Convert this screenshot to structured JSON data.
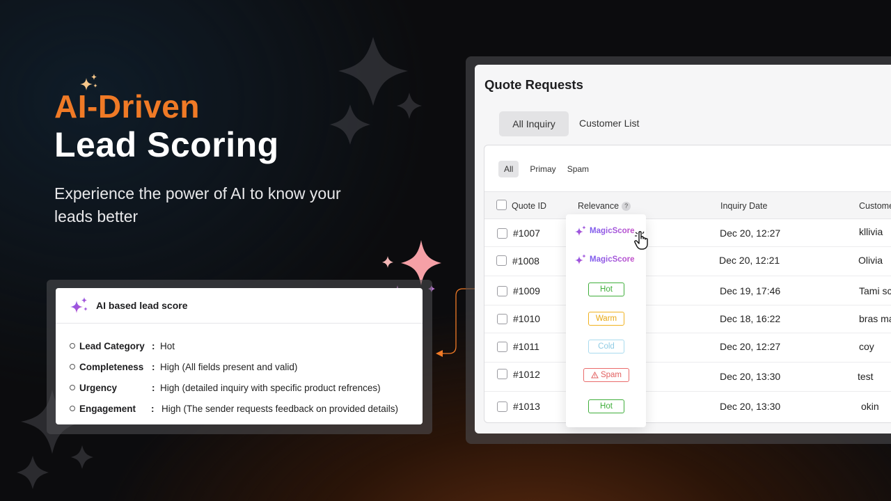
{
  "hero": {
    "title_accent": "AI-Driven",
    "title_main": "Lead Scoring",
    "subtitle": "Experience the power of AI to know your leads better"
  },
  "lead_card": {
    "title": "AI based lead score",
    "rows": [
      {
        "key": "Lead Category",
        "value": "Hot"
      },
      {
        "key": "Completeness",
        "value": "High (All fields present and valid)"
      },
      {
        "key": "Urgency",
        "value": "High (detailed inquiry with specific product refrences)"
      },
      {
        "key": "Engagement",
        "value": "High (The sender requests feedback on provided details)"
      }
    ]
  },
  "quote_requests": {
    "title": "Quote Requests",
    "tabs": [
      "All Inquiry",
      "Customer List"
    ],
    "filters": [
      "All",
      "Primay",
      "Spam"
    ],
    "columns": [
      "Quote ID",
      "Relevance",
      "Inquiry Date",
      "Custome"
    ],
    "help_glyph": "?",
    "magicscore_label": "MagicScore",
    "rows": [
      {
        "id": "#1007",
        "relevance": "MagicScore",
        "date": "Dec 20, 12:27",
        "customer": "kllivia"
      },
      {
        "id": "#1008",
        "relevance": "MagicScore",
        "date": "Dec 20, 12:21",
        "customer": "Olivia"
      },
      {
        "id": "#1009",
        "relevance": "Hot",
        "date": "Dec 19, 17:46",
        "customer": "Tami sc"
      },
      {
        "id": "#1010",
        "relevance": "Warm",
        "date": "Dec 18, 16:22",
        "customer": "bras ma"
      },
      {
        "id": "#1011",
        "relevance": "Cold",
        "date": "Dec 20, 12:27",
        "customer": "coy"
      },
      {
        "id": "#1012",
        "relevance": "Spam",
        "date": "Dec 20, 13:30",
        "customer": "test"
      },
      {
        "id": "#1013",
        "relevance": "Hot",
        "date": "Dec 20, 13:30",
        "customer": "okin"
      }
    ]
  },
  "colors": {
    "accent": "#f07a26",
    "hot": "#3fae3a",
    "warm": "#f1b21f",
    "cold": "#9fd6ec",
    "spam": "#ea6b6b"
  },
  "icons": [
    "sparkle-icon",
    "warning-icon",
    "pointer-hand-icon",
    "help-icon"
  ]
}
